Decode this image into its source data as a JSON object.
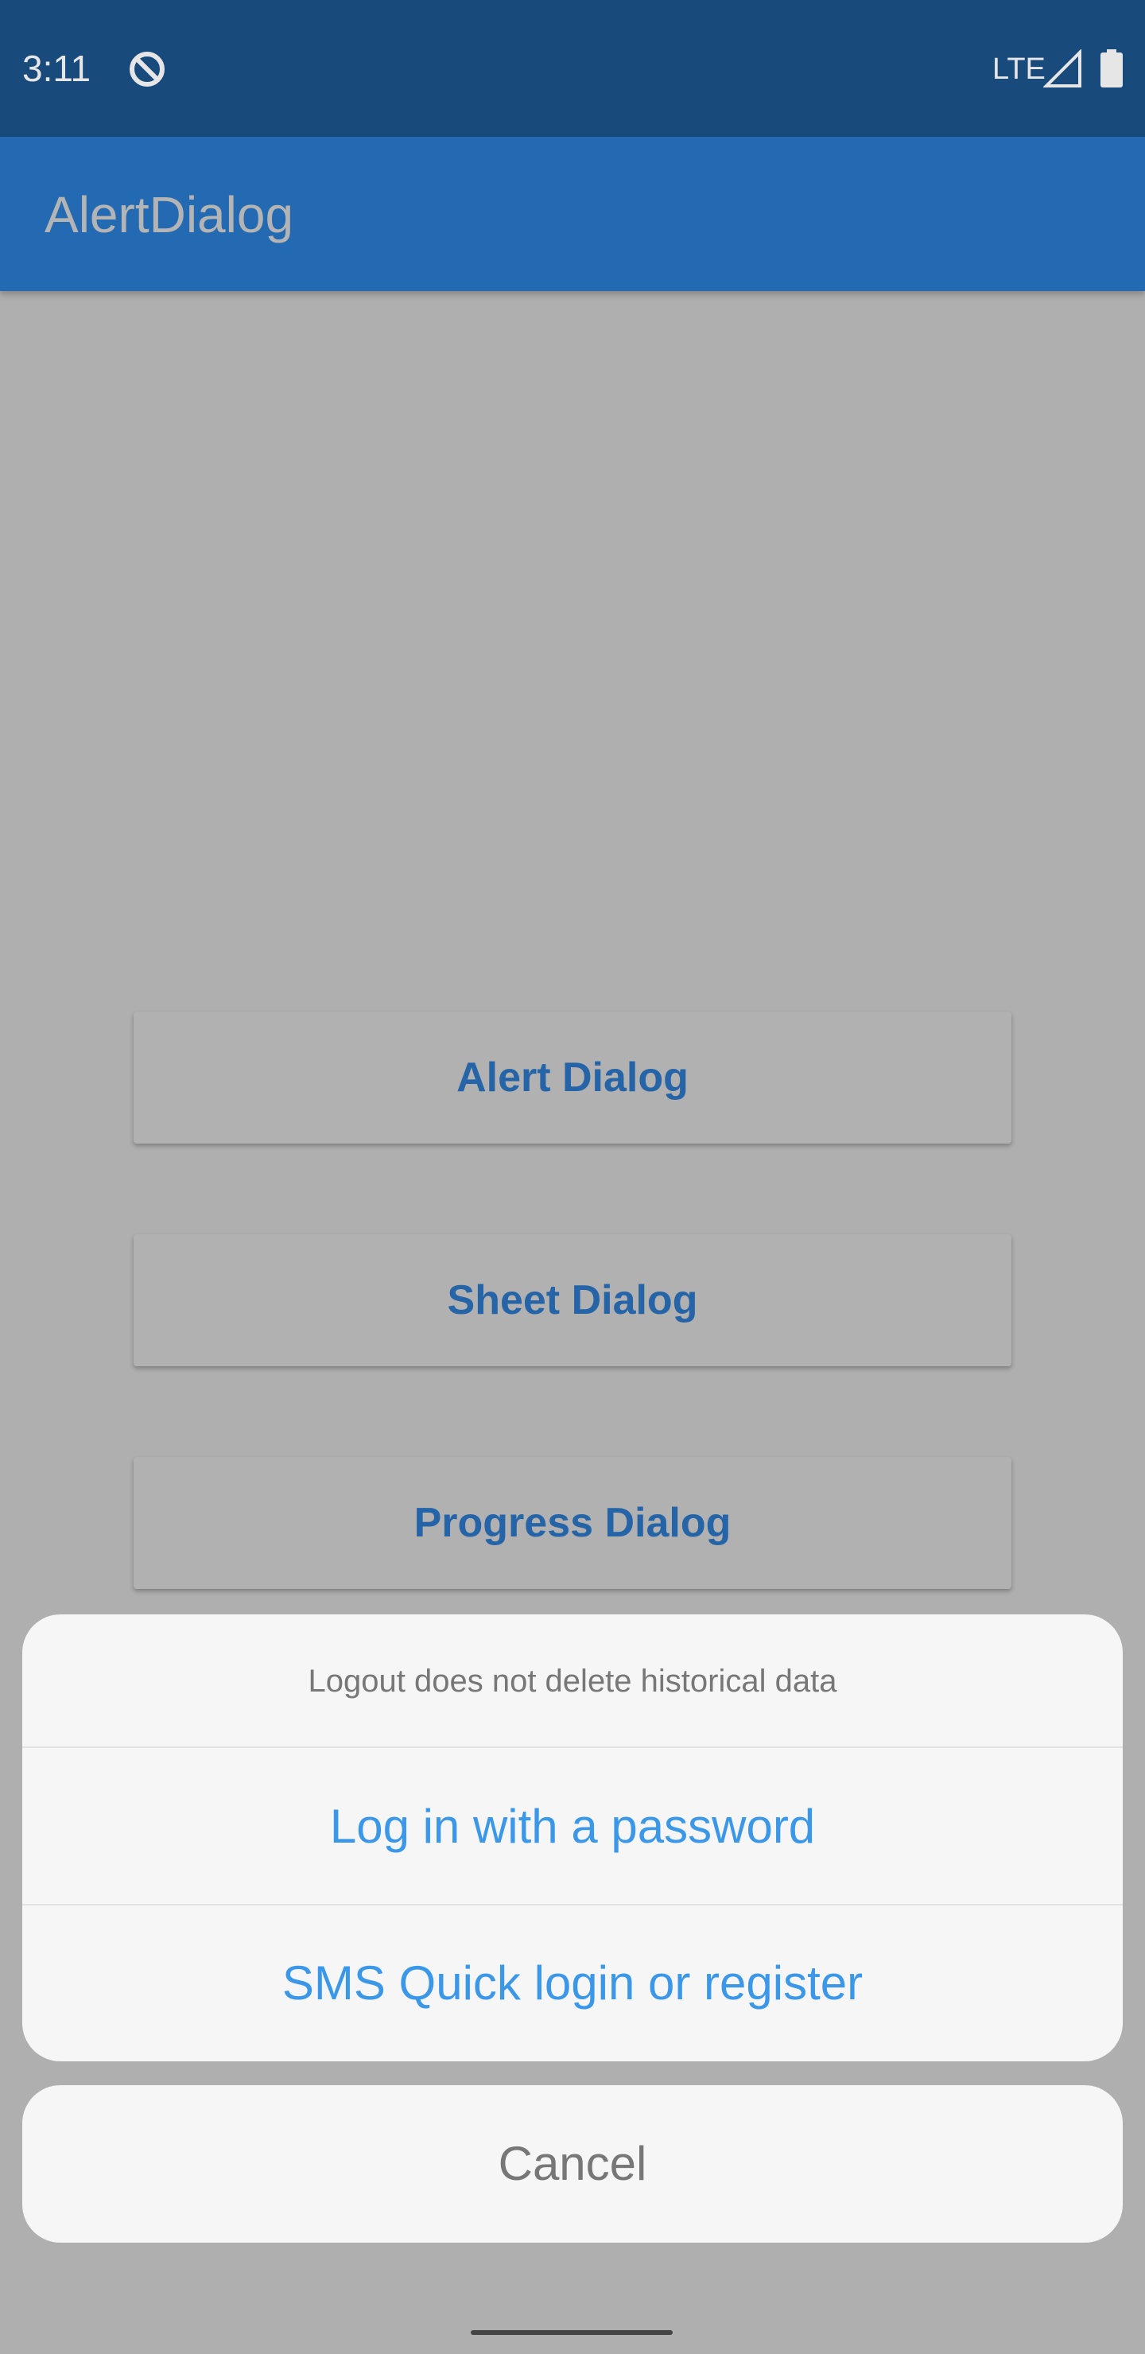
{
  "status_bar": {
    "time": "3:11",
    "network": "LTE",
    "icons": [
      "sync-disabled-icon",
      "signal-icon",
      "battery-icon"
    ]
  },
  "app_bar": {
    "title": "AlertDialog"
  },
  "buttons": {
    "alert": "Alert Dialog",
    "sheet": "Sheet Dialog",
    "progress": "Progress Dialog"
  },
  "sheet": {
    "header": "Logout does not delete historical data",
    "options": [
      "Log in with a password",
      "SMS Quick login or register"
    ],
    "cancel": "Cancel"
  },
  "colors": {
    "status_bar": "#184a7c",
    "app_bar": "#246ab2",
    "scrim_background": "#afafaf",
    "sheet_background": "#f6f6f6",
    "option_text": "#3b97e8",
    "button_text": "#2664a8"
  }
}
